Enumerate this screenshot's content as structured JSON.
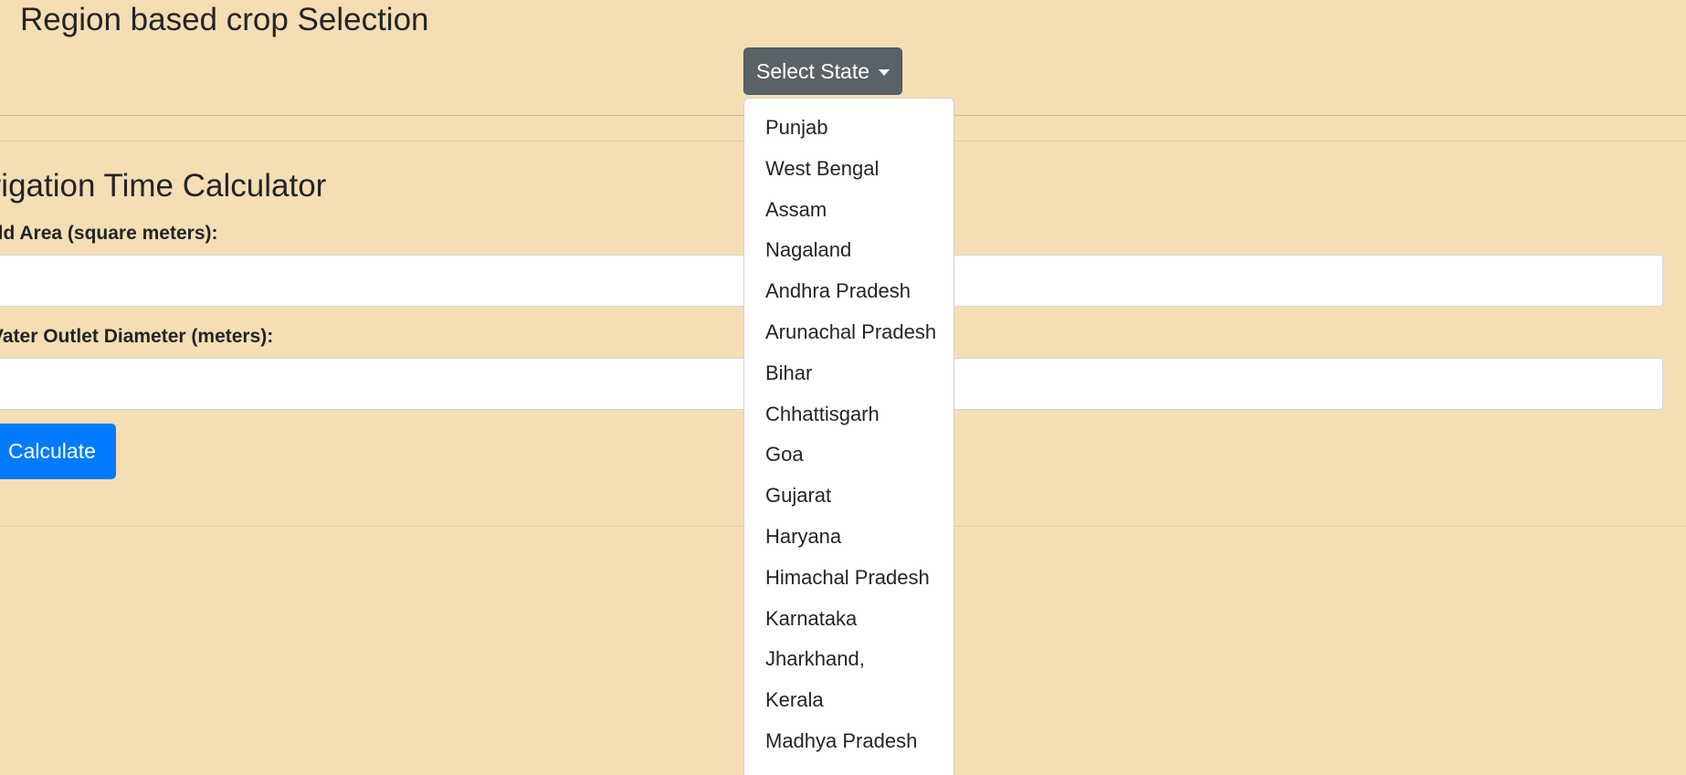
{
  "header": {
    "title": "Region based crop Selection",
    "state_dropdown_label": "Select State"
  },
  "dropdown": {
    "items": [
      "Punjab",
      "West Bengal",
      "Assam",
      "Nagaland",
      "Andhra Pradesh",
      "Arunachal Pradesh",
      "Bihar",
      "Chhattisgarh",
      "Goa",
      "Gujarat",
      "Haryana",
      "Himachal Pradesh",
      "Karnataka",
      "Jharkhand,",
      "Kerala",
      "Madhya Pradesh"
    ]
  },
  "calculator": {
    "heading": "rrigation Time Calculator",
    "field_area_label": "eld Area (square meters):",
    "field_area_value": "",
    "diameter_label": "Vater Outlet Diameter (meters):",
    "diameter_value": "",
    "calculate_label": "Calculate"
  },
  "colors": {
    "background": "#f5deb3",
    "dropdown_button": "#5a6268",
    "primary_button": "#007bff"
  }
}
